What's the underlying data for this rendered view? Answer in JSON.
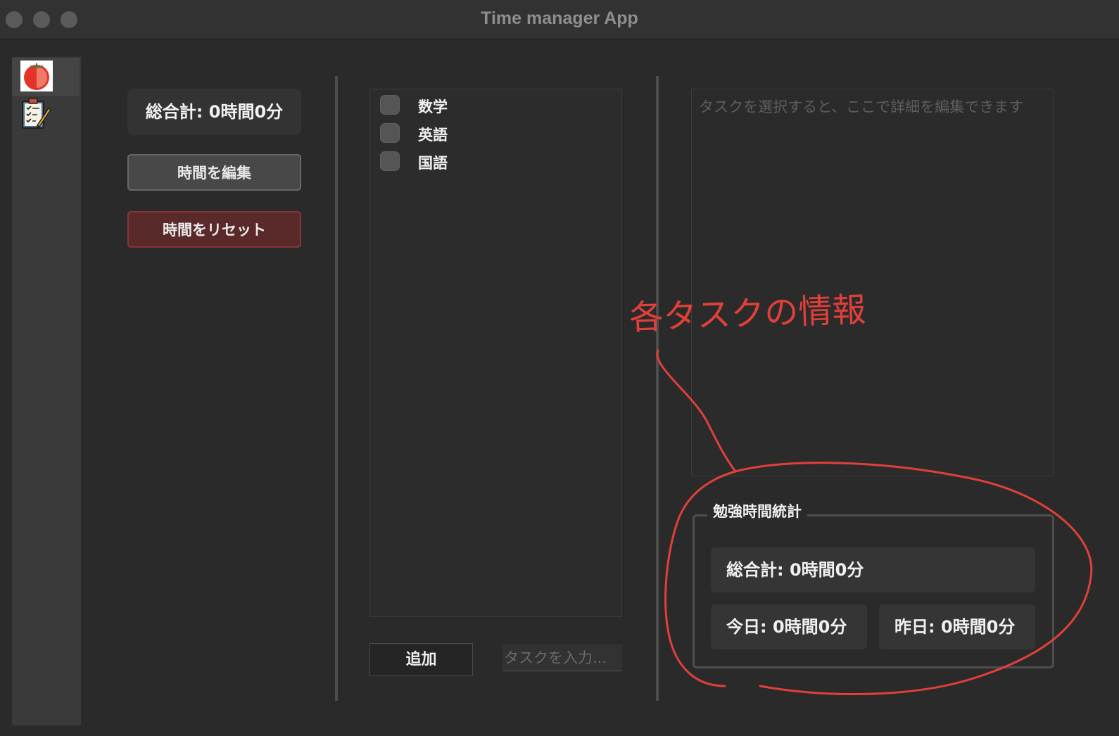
{
  "window": {
    "title": "Time manager App"
  },
  "sidebar": {
    "items": [
      {
        "name": "timer",
        "icon": "tomato-icon"
      },
      {
        "name": "tasks",
        "icon": "clipboard-checklist-icon"
      }
    ]
  },
  "timer_panel": {
    "total_label": "総合計: 0時間0分",
    "edit_button": "時間を編集",
    "reset_button": "時間をリセット"
  },
  "tasks": {
    "items": [
      {
        "label": "数学",
        "checked": false
      },
      {
        "label": "英語",
        "checked": false
      },
      {
        "label": "国語",
        "checked": false
      }
    ],
    "add_button": "追加",
    "input_placeholder": "タスクを入力..."
  },
  "details": {
    "placeholder": "タスクを選択すると、ここで詳細を編集できます"
  },
  "stats": {
    "title": "勉強時間統計",
    "total": "総合計: 0時間0分",
    "today": "今日: 0時間0分",
    "yesterday": "昨日: 0時間0分"
  },
  "annotation": {
    "text": "各タスクの情報",
    "color": "#e0403a"
  },
  "colors": {
    "background": "#2a2a2a",
    "reset_button": "#5a2a2a",
    "annotation_red": "#e0403a"
  }
}
